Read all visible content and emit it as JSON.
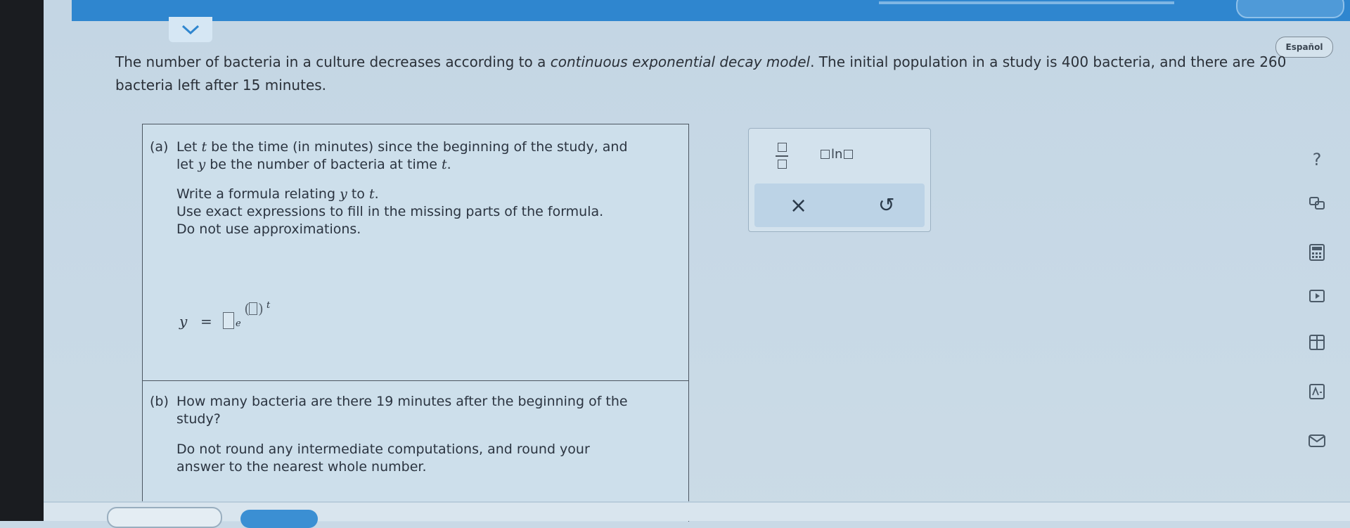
{
  "header": {
    "language_label": "Español"
  },
  "problem": {
    "text_before": "The number of bacteria in a culture decreases according to a ",
    "text_emph": "continuous exponential decay model",
    "text_after": ". The initial population in a study is 400 bacteria, and there are 260 bacteria left after 15 minutes."
  },
  "part_a": {
    "label": "(a)",
    "line1a": "Let ",
    "var_t": "t",
    "line1b": " be the time (in minutes) since the beginning of the study, and",
    "line2a": "let ",
    "var_y": "y",
    "line2b": " be the number of bacteria at time ",
    "line2c": ".",
    "line3a": "Write a formula relating ",
    "line3b": " to ",
    "line3c": ".",
    "line4": "Use exact expressions to fill in the missing parts of the formula.",
    "line5": "Do not use approximations.",
    "formula": {
      "lhs": "y",
      "equals": "=",
      "base": "e",
      "exp_var": "t"
    }
  },
  "part_b": {
    "label": "(b)",
    "line1": "How many bacteria are there 19 minutes after the beginning of the",
    "line2": "study?",
    "line3": "Do not round any intermediate computations, and round your",
    "line4": "answer to the nearest whole number."
  },
  "toolbox": {
    "ln_label": "ln",
    "clear_symbol": "×",
    "undo_symbol": "↺"
  },
  "side_tools": {
    "help_symbol": "?",
    "icons": [
      "help-icon",
      "glossary-icon",
      "calculator-icon",
      "video-icon",
      "table-icon",
      "text-size-icon",
      "mail-icon"
    ]
  },
  "colors": {
    "topbar": "#2f86cf",
    "accent": "#3b8fd3"
  }
}
